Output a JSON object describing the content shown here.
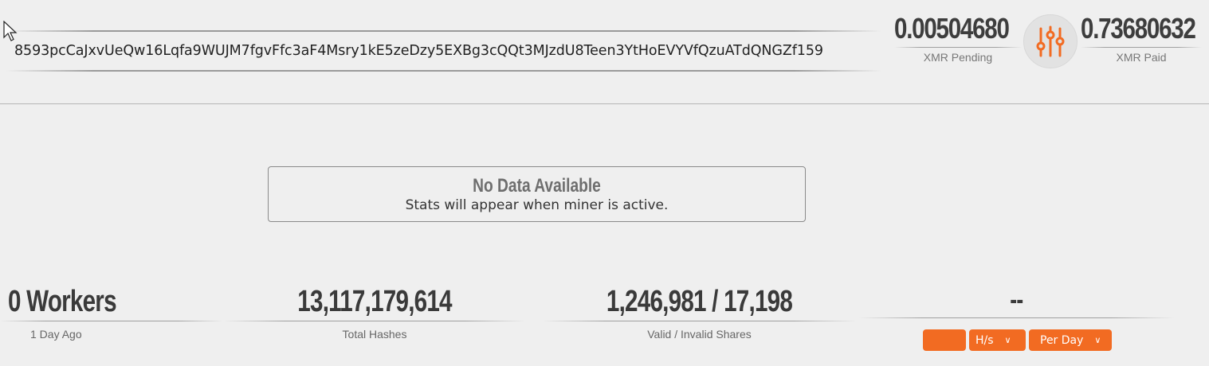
{
  "address": "8593pcCaJxvUeQw16Lqfa9WUJM7fgvFfc3aF4Msry1kE5zeDzy5EXBg3cQQt3MJzdU8Teen3YtHoEVYVfQzuATdQNGZf159",
  "balance": {
    "pending_value": "0.00504680",
    "pending_label": "XMR Pending",
    "paid_value": "0.73680632",
    "paid_label": "XMR Paid"
  },
  "notice": {
    "title": "No Data Available",
    "subtitle": "Stats will appear when miner is active."
  },
  "stats": {
    "workers_value": "0 Workers",
    "workers_label": "1 Day Ago",
    "hashes_value": "13,117,179,614",
    "hashes_label": "Total Hashes",
    "shares_value": "1,246,981 / 17,198",
    "shares_label": "Valid / Invalid Shares",
    "rate_value": "--"
  },
  "controls": {
    "input_value": "",
    "unit_select": "H/s",
    "period_select": "Per Day"
  },
  "colors": {
    "accent": "#f26b22",
    "background": "#efefef"
  }
}
